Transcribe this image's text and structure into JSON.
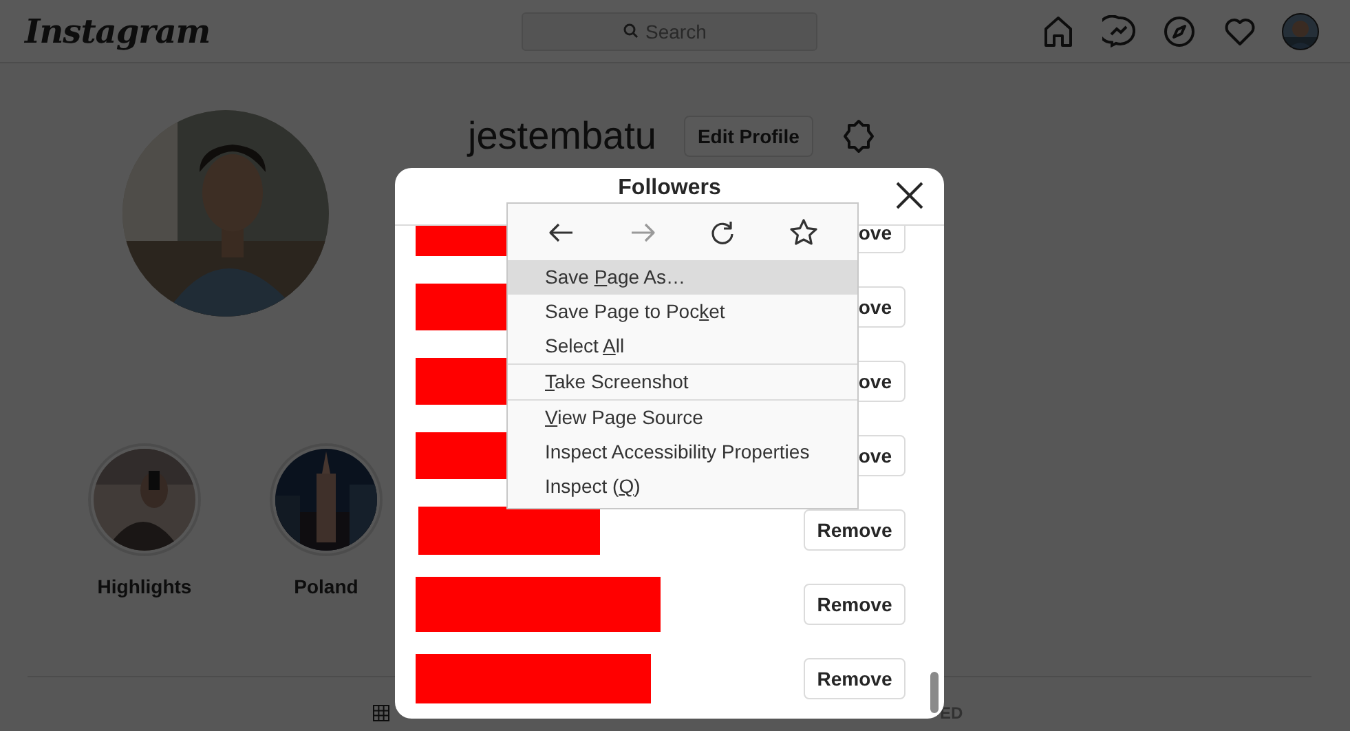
{
  "header": {
    "logo": "Instagram",
    "search": {
      "placeholder": "Search"
    }
  },
  "profile": {
    "username": "jestembatu",
    "edit_button": "Edit Profile"
  },
  "highlights": [
    {
      "label": "Highlights"
    },
    {
      "label": "Poland"
    }
  ],
  "profile_tabs": {
    "partial_label": "ED"
  },
  "dialog": {
    "title": "Followers",
    "rows": [
      {
        "button": "ove"
      },
      {
        "button": "ove"
      },
      {
        "button": "ove"
      },
      {
        "button": "ove"
      },
      {
        "button": "Remove"
      },
      {
        "button": "Remove"
      },
      {
        "button": "Remove"
      }
    ]
  },
  "context_menu": {
    "nav": [
      {
        "kind": "back",
        "disabled": false
      },
      {
        "kind": "forward",
        "disabled": true
      },
      {
        "kind": "reload",
        "disabled": false
      },
      {
        "kind": "bookmark",
        "disabled": false
      }
    ],
    "items": [
      {
        "before": "Save ",
        "key": "P",
        "after": "age As…",
        "selected": true,
        "separator_before": false
      },
      {
        "before": "Save Page to Poc",
        "key": "k",
        "after": "et",
        "selected": false,
        "separator_before": false
      },
      {
        "before": "Select ",
        "key": "A",
        "after": "ll",
        "selected": false,
        "separator_before": false
      },
      {
        "key": "T",
        "after": "ake Screenshot",
        "selected": false,
        "separator_before": true
      },
      {
        "key": "V",
        "after": "iew Page Source",
        "selected": false,
        "separator_before": true
      },
      {
        "before": "Inspect Accessibility Properties",
        "selected": false,
        "separator_before": false
      },
      {
        "before": "Inspect (",
        "key": "Q",
        "after": ")",
        "selected": false,
        "separator_before": false
      }
    ]
  }
}
